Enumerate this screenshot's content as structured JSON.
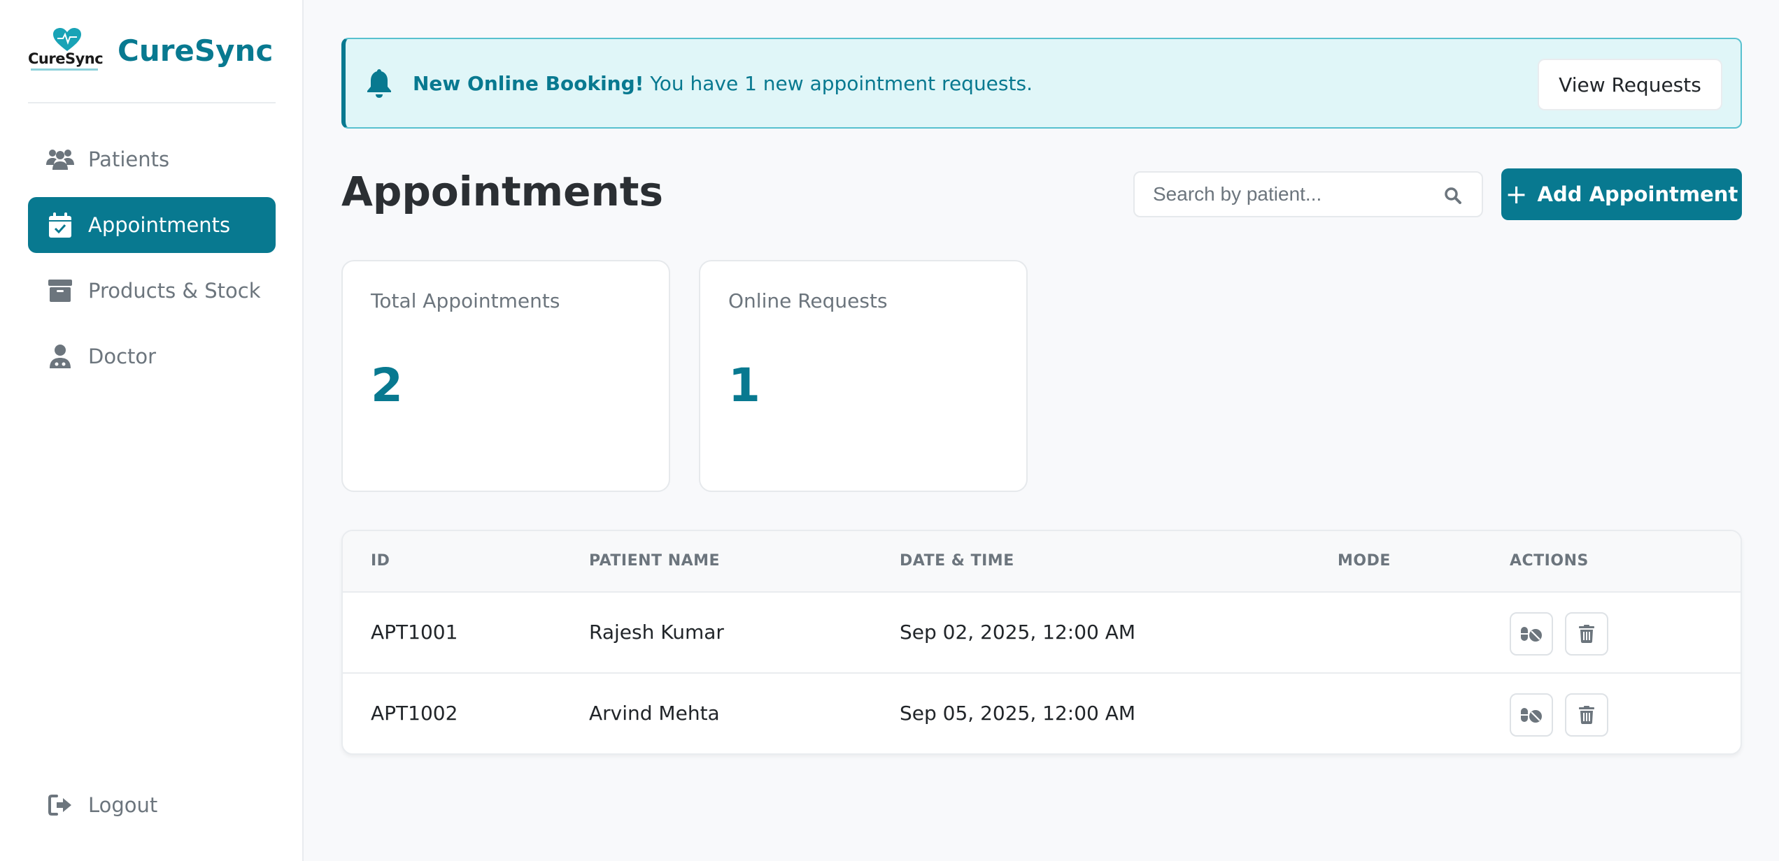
{
  "brand": {
    "logo_text": "CureSync",
    "name": "CureSync"
  },
  "sidebar": {
    "items": [
      {
        "label": "Patients",
        "icon": "users-icon",
        "active": false
      },
      {
        "label": "Appointments",
        "icon": "calendar-check-icon",
        "active": true
      },
      {
        "label": "Products & Stock",
        "icon": "archive-box-icon",
        "active": false
      },
      {
        "label": "Doctor",
        "icon": "doctor-icon",
        "active": false
      }
    ],
    "logout": "Logout"
  },
  "alert": {
    "title": "New Online Booking!",
    "message": " You have 1 new appointment requests.",
    "button": "View Requests"
  },
  "main": {
    "title": "Appointments",
    "search_placeholder": "Search by patient...",
    "add_button": "Add Appointment"
  },
  "stats": [
    {
      "label": "Total Appointments",
      "value": "2"
    },
    {
      "label": "Online Requests",
      "value": "1"
    }
  ],
  "table": {
    "columns": [
      "ID",
      "PATIENT NAME",
      "DATE & TIME",
      "MODE",
      "ACTIONS"
    ],
    "rows": [
      {
        "id": "APT1001",
        "patient": "Rajesh Kumar",
        "datetime": "Sep 02, 2025, 12:00 AM",
        "mode": ""
      },
      {
        "id": "APT1002",
        "patient": "Arvind Mehta",
        "datetime": "Sep 05, 2025, 12:00 AM",
        "mode": ""
      }
    ]
  },
  "colors": {
    "accent": "#087990",
    "alert_bg": "#e0f6f8",
    "page_bg": "#f8f9fb"
  }
}
